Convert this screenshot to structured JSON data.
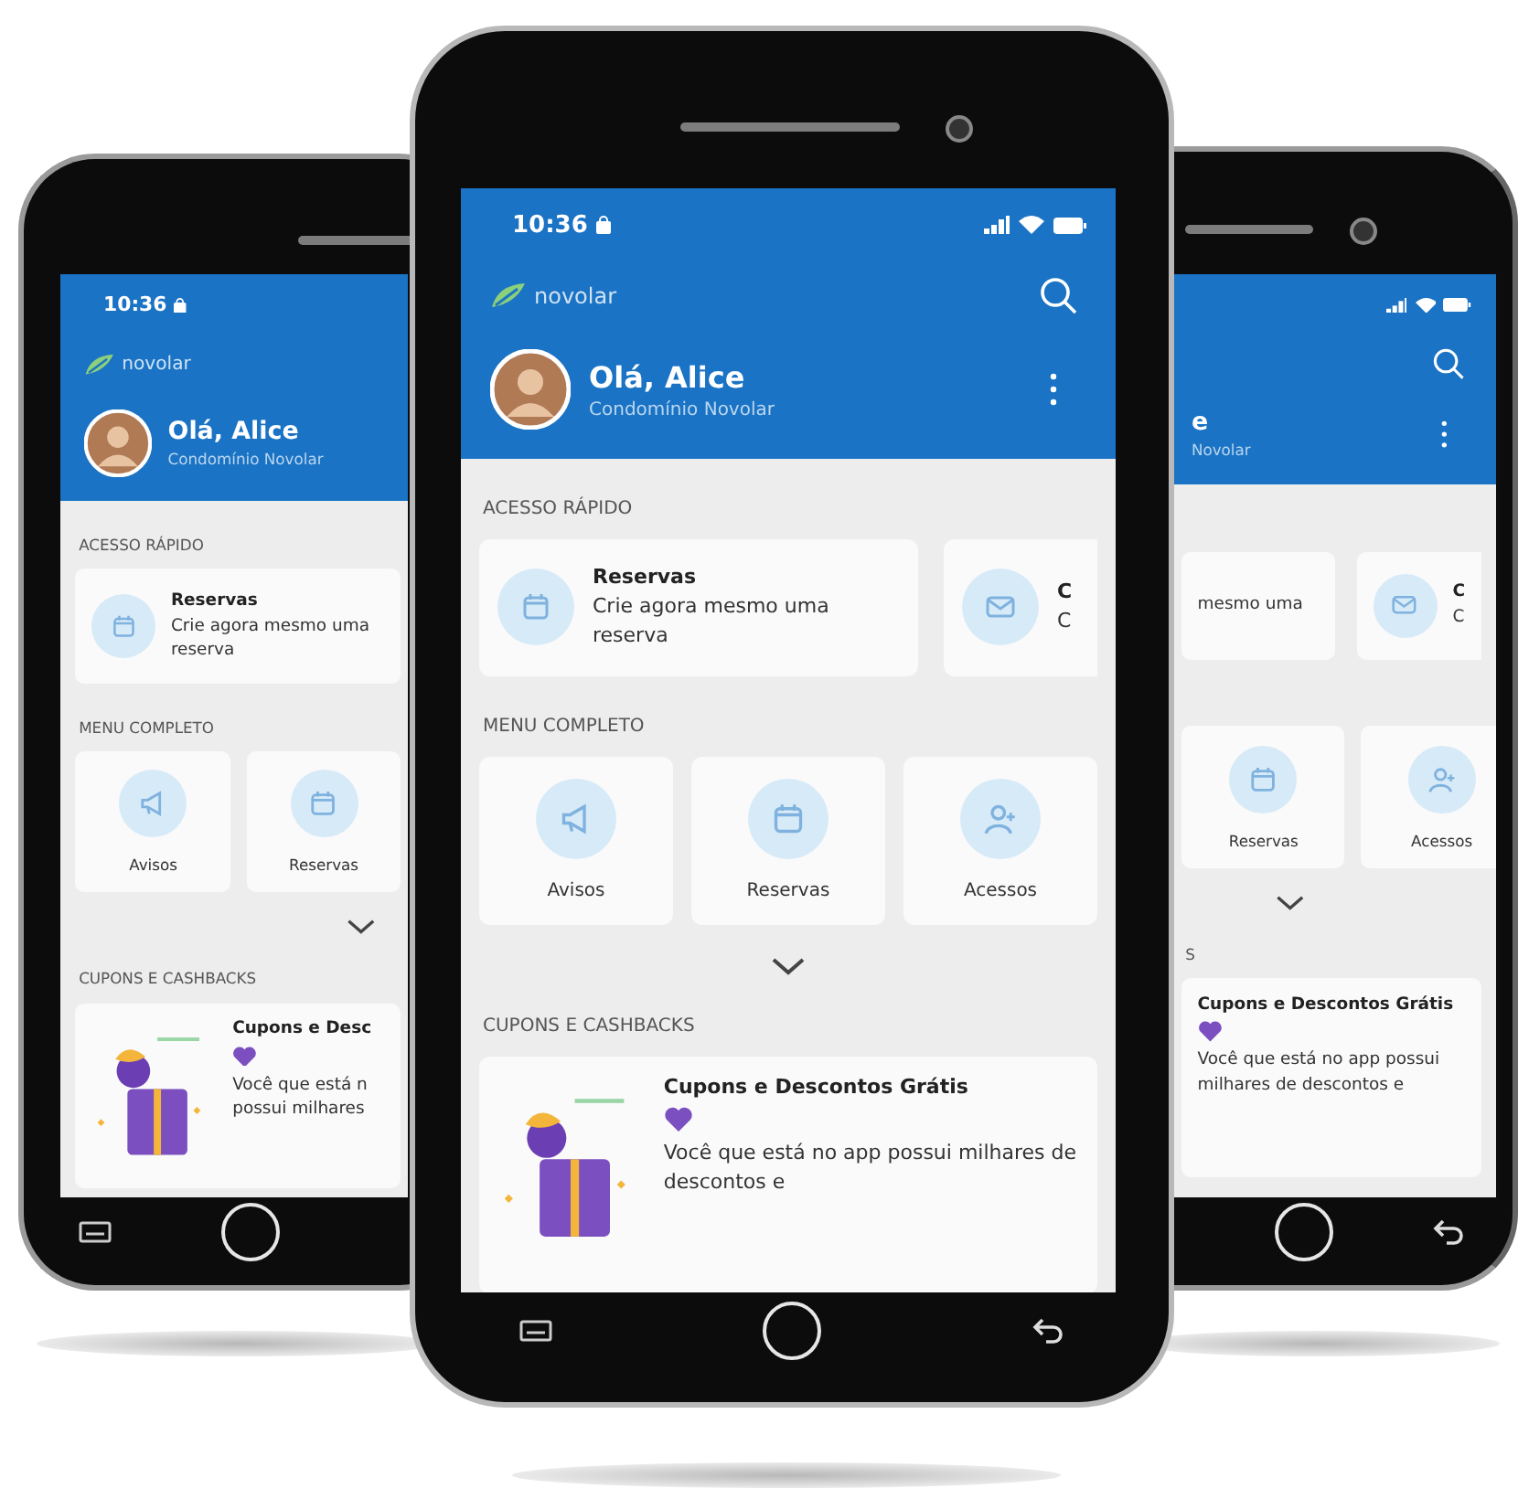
{
  "phones": [
    {
      "kind": "left",
      "status_bar": {
        "time": "10:36"
      },
      "brand": "novolar",
      "greeting": "Olá, Alice",
      "condo": "Condomínio Novolar",
      "quick_access": {
        "title": "ACESSO RÁPIDO",
        "cards": [
          {
            "title": "Reservas",
            "text": "Crie agora mesmo uma reserva"
          }
        ]
      },
      "menu": {
        "title": "MENU COMPLETO",
        "items": [
          {
            "label": "Avisos"
          },
          {
            "label": "Reservas"
          }
        ]
      },
      "coupons": {
        "title": "CUPONS E CASHBACKS",
        "card": {
          "title": "Cupons e Desc",
          "text": "Você que está n possui milhares"
        }
      }
    },
    {
      "kind": "center",
      "status_bar": {
        "time": "10:36"
      },
      "brand": "novolar",
      "greeting": "Olá, Alice",
      "condo": "Condomínio Novolar",
      "quick_access": {
        "title": "ACESSO RÁPIDO",
        "cards": [
          {
            "title": "Reservas",
            "text": "Crie agora mesmo uma reserva"
          },
          {
            "title": "C",
            "text": "C"
          }
        ]
      },
      "menu": {
        "title": "MENU COMPLETO",
        "items": [
          {
            "label": "Avisos"
          },
          {
            "label": "Reservas"
          },
          {
            "label": "Acessos"
          }
        ]
      },
      "coupons": {
        "title": "CUPONS E CASHBACKS",
        "card": {
          "title": "Cupons e Descontos Grátis",
          "text": "Você que está no app possui milhares de descontos e"
        }
      }
    },
    {
      "kind": "right",
      "greeting": "e",
      "condo": "Novolar",
      "quick_access": {
        "cards": [
          {
            "text": "mesmo uma"
          },
          {
            "title": "C",
            "text": "C"
          }
        ]
      },
      "menu": {
        "items": [
          {
            "label": "Reservas"
          },
          {
            "label": "Acessos"
          }
        ]
      },
      "coupons": {
        "title": "S",
        "card": {
          "title": "Cupons e Descontos Grátis",
          "text": "Você que está no app possui milhares de descontos e"
        }
      }
    }
  ]
}
